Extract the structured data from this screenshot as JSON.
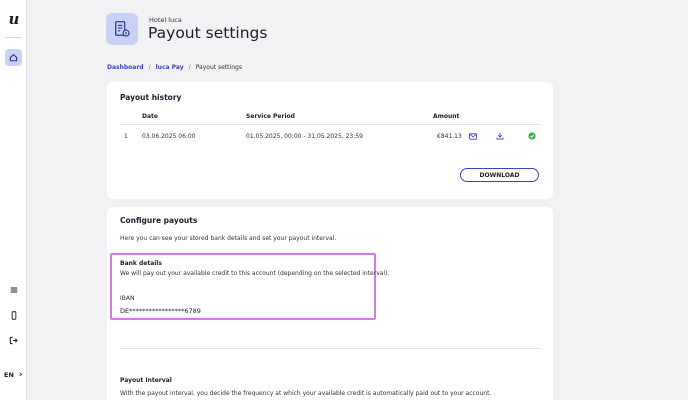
{
  "sidebar": {
    "logo": "u",
    "lang": "EN",
    "lang_chevron": "›"
  },
  "header": {
    "subtitle": "Hotel luca",
    "title": "Payout settings"
  },
  "breadcrumb": {
    "items": [
      "Dashboard",
      "luca Pay",
      "Payout settings"
    ],
    "separator": "/"
  },
  "payout_history": {
    "title": "Payout history",
    "columns": [
      "Date",
      "Service Period",
      "Amount"
    ],
    "rows": [
      {
        "index": "1",
        "date": "03.06.2025 06:00",
        "period": "01.05.2025, 00:00 - 31.05.2025, 23:59",
        "amount": "€841.13"
      }
    ],
    "download_label": "DOWNLOAD"
  },
  "configure": {
    "title": "Configure payouts",
    "description": "Here you can see your stored bank details and set your payout interval.",
    "bank_title": "Bank details",
    "bank_description": "We will pay out your available credit to this account (depending on the selected interval).",
    "iban_label": "IBAN",
    "iban_value": "DE*****************6789",
    "interval_title": "Payout Interval",
    "interval_description": "With the payout interval, you decide the frequency at which your available credit is automatically paid out to your account."
  },
  "colors": {
    "accent": "#3a47b8",
    "highlight": "#d27ae6",
    "icon_bg": "#c9d2f5",
    "success": "#3fae49"
  }
}
